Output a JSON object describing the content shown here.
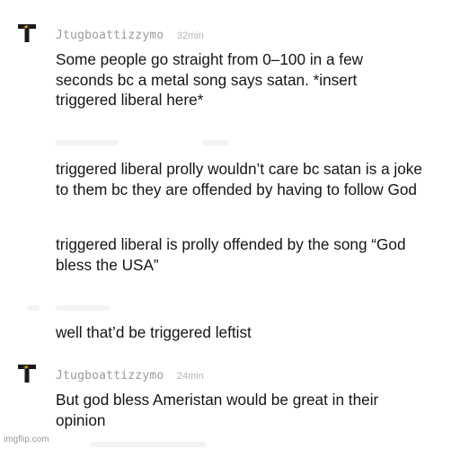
{
  "comments": [
    {
      "username": "Jtugboattizzymo",
      "time": "32min",
      "text": "Some people go straight from 0–100 in a few seconds bc a metal song says satan. *insert triggered liberal here*"
    },
    {
      "text": "triggered liberal prolly wouldn’t care bc satan is a joke to them bc they are offended by having to follow God"
    },
    {
      "text": "triggered liberal is prolly offended by the song “God bless the USA”"
    },
    {
      "text": "well that’d be triggered leftist"
    },
    {
      "username": "Jtugboattizzymo",
      "time": "24min",
      "text": "But god bless Ameristan would be great in their opinion"
    }
  ],
  "avatar_icon": "lightning-bolt-icon",
  "accent_color": "#e3b21c",
  "watermark": "imgflip.com"
}
